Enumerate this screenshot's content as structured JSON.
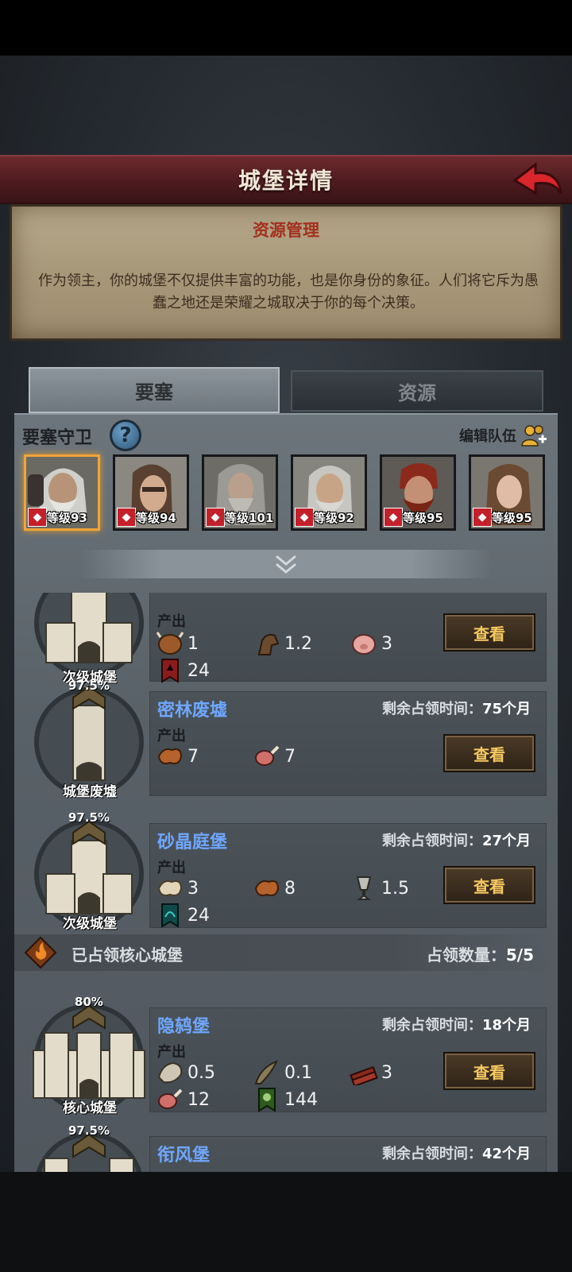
{
  "header": {
    "title": "城堡详情"
  },
  "info": {
    "title": "资源管理",
    "text": "作为领主，你的城堡不仅提供丰富的功能，也是你身份的象征。人们将它斥为愚蠢之地还是荣耀之城取决于你的每个决策。"
  },
  "tabs": {
    "fortress": "要塞",
    "resource": "资源"
  },
  "guards": {
    "title": "要塞守卫",
    "help": "?",
    "edit_team": "编辑队伍",
    "heroes": [
      {
        "level": "等级93"
      },
      {
        "level": "等级94"
      },
      {
        "level": "等级101"
      },
      {
        "level": "等级92"
      },
      {
        "level": "等级95"
      },
      {
        "level": "等级95"
      }
    ]
  },
  "labels": {
    "output": "产出",
    "view": "查看",
    "remaining": "剩余占领时间："
  },
  "castles": [
    {
      "type": "次级城堡",
      "resources": [
        {
          "icon": "cow-hide-icon",
          "value": "1"
        },
        {
          "icon": "horse-icon",
          "value": "1.2"
        },
        {
          "icon": "pig-icon",
          "value": "3"
        },
        {
          "icon": "red-banner-icon",
          "value": "24"
        }
      ]
    },
    {
      "pct": "97.5%",
      "name": "密林废墟",
      "remaining": "75个月",
      "type": "城堡废墟",
      "resources": [
        {
          "icon": "leather-icon",
          "value": "7"
        },
        {
          "icon": "meat-leg-icon",
          "value": "7"
        }
      ]
    },
    {
      "pct": "97.5%",
      "name": "砂晶庭堡",
      "remaining": "27个月",
      "type": "次级城堡",
      "resources": [
        {
          "icon": "pale-hide-icon",
          "value": "3"
        },
        {
          "icon": "leather-icon",
          "value": "8"
        },
        {
          "icon": "goblet-icon",
          "value": "1.5"
        },
        {
          "icon": "teal-banner-icon",
          "value": "24"
        }
      ]
    }
  ],
  "core": {
    "title": "已占领核心城堡",
    "count_label": "占领数量：",
    "count": "5/5"
  },
  "core_castles": [
    {
      "pct": "80%",
      "name": "隐鸫堡",
      "remaining": "18个月",
      "type": "核心城堡",
      "resources": [
        {
          "icon": "fur-icon",
          "value": "0.5"
        },
        {
          "icon": "horn-icon",
          "value": "0.1"
        },
        {
          "icon": "wood-planks-icon",
          "value": "3"
        },
        {
          "icon": "meat-leg-icon",
          "value": "12"
        },
        {
          "icon": "green-banner-icon",
          "value": "144"
        }
      ]
    },
    {
      "pct": "97.5%",
      "name": "衔风堡",
      "remaining": "42个月"
    }
  ]
}
